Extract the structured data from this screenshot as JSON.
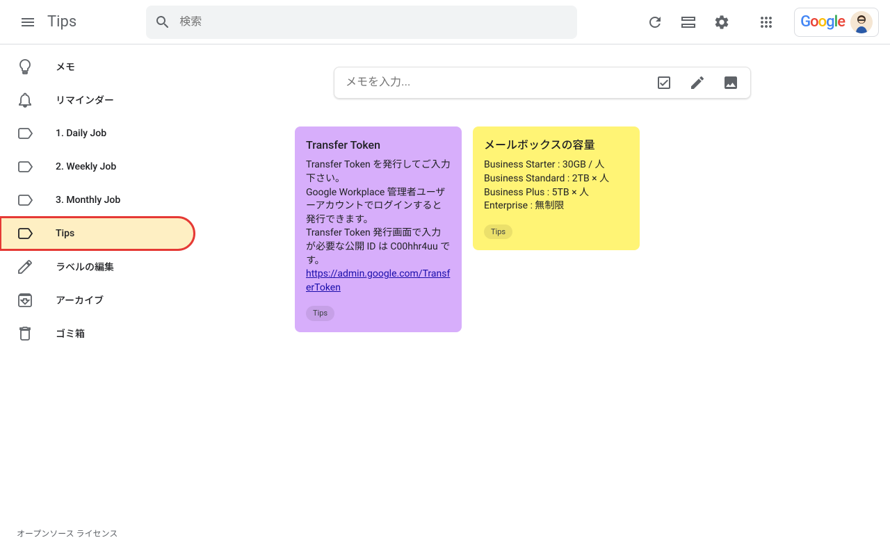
{
  "header": {
    "app_title": "Tips",
    "search_placeholder": "検索"
  },
  "sidebar": {
    "items": [
      {
        "icon": "lightbulb",
        "label": "メモ"
      },
      {
        "icon": "bell",
        "label": "リマインダー"
      },
      {
        "icon": "label",
        "label": "1. Daily Job"
      },
      {
        "icon": "label",
        "label": "2. Weekly Job"
      },
      {
        "icon": "label",
        "label": "3. Monthly Job"
      },
      {
        "icon": "label",
        "label": "Tips",
        "active": true,
        "highlighted": true
      },
      {
        "icon": "pencil",
        "label": "ラベルの編集"
      },
      {
        "icon": "archive",
        "label": "アーカイブ"
      },
      {
        "icon": "trash",
        "label": "ゴミ箱"
      }
    ],
    "footer_link": "オープンソース ライセンス"
  },
  "note_input": {
    "placeholder": "メモを入力..."
  },
  "notes": [
    {
      "color": "purple",
      "title": "Transfer Token",
      "body_lines": [
        "Transfer Token を発行してご入力下さい。",
        "Google Workplace 管理者ユーザーアカウントでログインすると発行できます。",
        "Transfer Token 発行画面で入力が必要な公開 ID は C00hhr4uu です。"
      ],
      "link": "https://admin.google.com/TransferToken",
      "tag": "Tips"
    },
    {
      "color": "yellow",
      "title": "メールボックスの容量",
      "body_lines": [
        "Business Starter : 30GB / 人",
        "Business Standard : 2TB × 人",
        "Business Plus : 5TB × 人",
        "Enterprise : 無制限"
      ],
      "tag": "Tips"
    }
  ]
}
